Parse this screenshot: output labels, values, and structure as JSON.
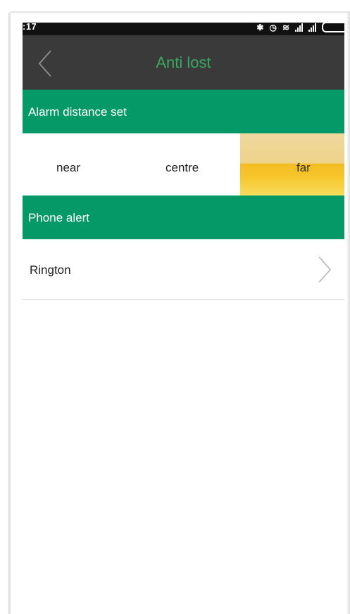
{
  "status_bar": {
    "time": ":17",
    "icons": [
      "bluetooth-icon",
      "alarm-icon",
      "wifi-icon",
      "signal-icon",
      "signal-icon",
      "battery-icon"
    ]
  },
  "header": {
    "title": "Anti lost",
    "back_icon": "chevron-left-icon"
  },
  "alarm_section": {
    "title": "Alarm distance set",
    "options": [
      {
        "label": "near",
        "selected": false
      },
      {
        "label": "centre",
        "selected": false
      },
      {
        "label": "far",
        "selected": true
      }
    ]
  },
  "phone_section": {
    "title": "Phone alert",
    "items": [
      {
        "label": "Rington",
        "icon": "chevron-right-icon"
      }
    ]
  },
  "colors": {
    "header_bg": "#3a3a3a",
    "title_green": "#3aa860",
    "section_green": "#069968",
    "selected_yellow": "#f6c52b"
  }
}
